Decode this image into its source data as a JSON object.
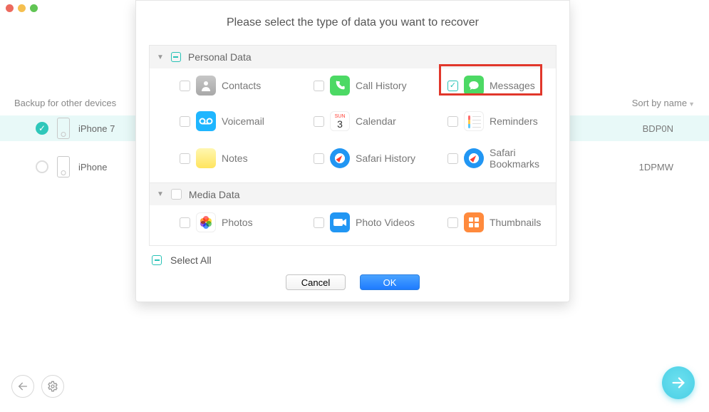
{
  "window": {
    "close": "close",
    "min": "minimize",
    "zoom": "zoom"
  },
  "background": {
    "backup_label": "Backup for other devices",
    "sort_label": "Sort by name",
    "devices": [
      {
        "name": "iPhone 7",
        "serial_tail": "BDP0N",
        "selected": true
      },
      {
        "name": "iPhone",
        "serial_tail": "1DPMW",
        "selected": false
      }
    ]
  },
  "modal": {
    "title": "Please select the type of data you want to recover",
    "sections": [
      {
        "label": "Personal Data",
        "items": [
          {
            "key": "contacts",
            "label": "Contacts",
            "checked": false
          },
          {
            "key": "callhist",
            "label": "Call History",
            "checked": false
          },
          {
            "key": "messages",
            "label": "Messages",
            "checked": true,
            "highlight": true
          },
          {
            "key": "voicemail",
            "label": "Voicemail",
            "checked": false
          },
          {
            "key": "calendar",
            "label": "Calendar",
            "checked": false
          },
          {
            "key": "reminders",
            "label": "Reminders",
            "checked": false
          },
          {
            "key": "notes",
            "label": "Notes",
            "checked": false
          },
          {
            "key": "safarihist",
            "label": "Safari History",
            "checked": false
          },
          {
            "key": "safaribook",
            "label": "Safari Bookmarks",
            "checked": false
          }
        ]
      },
      {
        "label": "Media Data",
        "items": [
          {
            "key": "photos",
            "label": "Photos",
            "checked": false
          },
          {
            "key": "photovideos",
            "label": "Photo Videos",
            "checked": false
          },
          {
            "key": "thumbnails",
            "label": "Thumbnails",
            "checked": false
          }
        ]
      }
    ],
    "select_all": "Select All",
    "cancel": "Cancel",
    "ok": "OK",
    "calendar_month": "SUN",
    "calendar_day": "3"
  },
  "nav": {
    "back": "←",
    "settings": "⚙",
    "next": "→"
  }
}
